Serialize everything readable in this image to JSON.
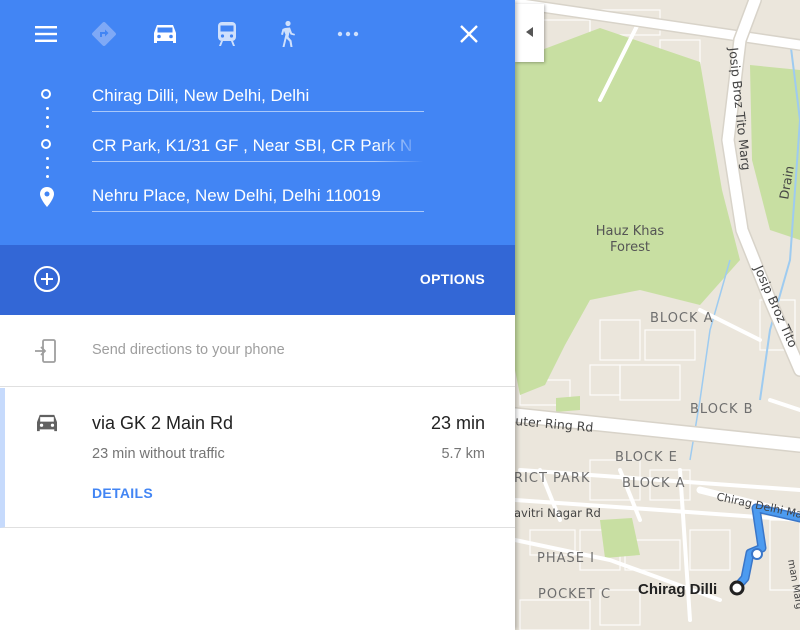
{
  "travel_modes": [
    {
      "name": "best-route",
      "icon": "diamond-turn-icon"
    },
    {
      "name": "driving",
      "icon": "car-icon",
      "selected": true
    },
    {
      "name": "transit",
      "icon": "train-icon"
    },
    {
      "name": "walking",
      "icon": "walk-icon"
    },
    {
      "name": "more",
      "icon": "more-dots-icon"
    }
  ],
  "stops": [
    {
      "value": "Chirag Dilli, New Delhi, Delhi"
    },
    {
      "value": "CR Park, K1/31 GF , Near SBI, CR Park N"
    },
    {
      "value": "Nehru Place, New Delhi, Delhi 110019"
    }
  ],
  "options_label": "OPTIONS",
  "send_directions_label": "Send directions to your phone",
  "route": {
    "title": "via GK 2 Main Rd",
    "time": "23 min",
    "subtitle": "23 min without traffic",
    "distance": "5.7 km",
    "details_label": "DETAILS"
  },
  "map": {
    "labels": {
      "forest_line1": "Hauz Khas",
      "forest_line2": "Forest",
      "road_tito_1": "Josip Broz Tito Marg",
      "road_tito_2": "Josip Broz Tito",
      "road_outer_ring": "uter Ring Rd",
      "road_drain": "Drain",
      "road_chirag": "Chirag Delhi Ma",
      "road_savitri": "avitri Nagar Rd",
      "block_a1": "BLOCK A",
      "block_b": "BLOCK B",
      "block_e": "BLOCK E",
      "block_a2": "BLOCK A",
      "rict_park": "RICT PARK",
      "phase_i": "PHASE I",
      "pocket_c": "POCKET C",
      "place": "Chirag Dilli",
      "side_label": "man Marg"
    }
  },
  "colors": {
    "header_blue": "#4285f4",
    "options_bar_blue": "#3367d6",
    "route_line": "#4c9bf0",
    "park_green": "#c8dfa2"
  }
}
